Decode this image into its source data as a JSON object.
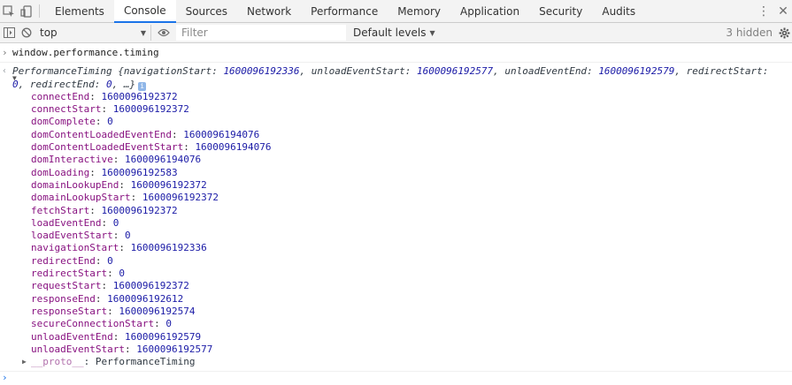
{
  "tabs": [
    {
      "label": "Elements"
    },
    {
      "label": "Console",
      "active": true
    },
    {
      "label": "Sources"
    },
    {
      "label": "Network"
    },
    {
      "label": "Performance"
    },
    {
      "label": "Memory"
    },
    {
      "label": "Application"
    },
    {
      "label": "Security"
    },
    {
      "label": "Audits"
    }
  ],
  "toolbar": {
    "context": "top",
    "filter_placeholder": "Filter",
    "levels": "Default levels",
    "hidden": "3 hidden"
  },
  "console": {
    "command": "window.performance.timing",
    "summary": {
      "type": "PerformanceTiming",
      "pairs": [
        {
          "k": "navigationStart",
          "v": "1600096192336"
        },
        {
          "k": "unloadEventStart",
          "v": "1600096192577"
        },
        {
          "k": "unloadEventEnd",
          "v": "1600096192579"
        },
        {
          "k": "redirectStart",
          "v": "0"
        },
        {
          "k": "redirectEnd",
          "v": "0"
        }
      ]
    },
    "properties": [
      {
        "key": "connectEnd",
        "value": "1600096192372"
      },
      {
        "key": "connectStart",
        "value": "1600096192372"
      },
      {
        "key": "domComplete",
        "value": "0"
      },
      {
        "key": "domContentLoadedEventEnd",
        "value": "1600096194076"
      },
      {
        "key": "domContentLoadedEventStart",
        "value": "1600096194076"
      },
      {
        "key": "domInteractive",
        "value": "1600096194076"
      },
      {
        "key": "domLoading",
        "value": "1600096192583"
      },
      {
        "key": "domainLookupEnd",
        "value": "1600096192372"
      },
      {
        "key": "domainLookupStart",
        "value": "1600096192372"
      },
      {
        "key": "fetchStart",
        "value": "1600096192372"
      },
      {
        "key": "loadEventEnd",
        "value": "0"
      },
      {
        "key": "loadEventStart",
        "value": "0"
      },
      {
        "key": "navigationStart",
        "value": "1600096192336"
      },
      {
        "key": "redirectEnd",
        "value": "0"
      },
      {
        "key": "redirectStart",
        "value": "0"
      },
      {
        "key": "requestStart",
        "value": "1600096192372"
      },
      {
        "key": "responseEnd",
        "value": "1600096192612"
      },
      {
        "key": "responseStart",
        "value": "1600096192574"
      },
      {
        "key": "secureConnectionStart",
        "value": "0"
      },
      {
        "key": "unloadEventEnd",
        "value": "1600096192579"
      },
      {
        "key": "unloadEventStart",
        "value": "1600096192577"
      }
    ],
    "proto": {
      "key": "__proto__",
      "value": "PerformanceTiming"
    }
  }
}
